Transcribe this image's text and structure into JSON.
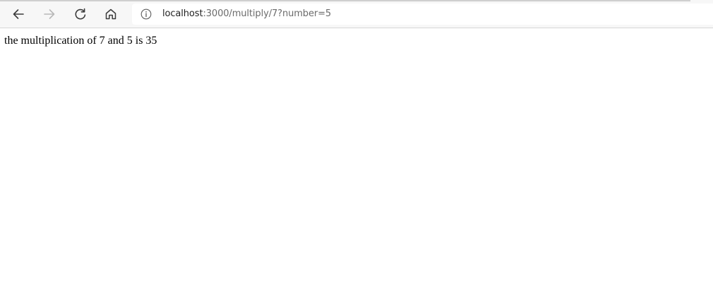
{
  "browser": {
    "nav": {
      "back_icon": "arrow-left-icon",
      "forward_icon": "arrow-right-icon",
      "reload_icon": "reload-icon",
      "home_icon": "home-icon"
    },
    "address_bar": {
      "security_icon": "info-icon",
      "url_host": "localhost",
      "url_path": ":3000/multiply/7?number=5"
    },
    "colors": {
      "toolbar_bg": "#f7f7f7",
      "icon_active": "#3b3b3b",
      "icon_disabled": "#b8b8b8",
      "url_host": "#1f1f1f",
      "url_path": "#6b6b6b"
    }
  },
  "page": {
    "result_text": "the multiplication of 7 and 5 is 35"
  }
}
